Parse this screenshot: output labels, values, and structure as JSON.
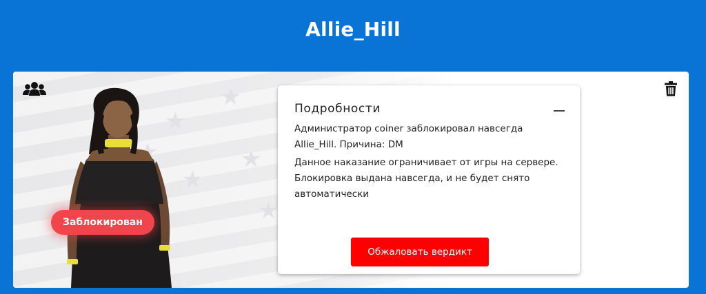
{
  "header": {
    "title": "Allie_Hill"
  },
  "card": {
    "status_badge": "Заблокирован",
    "details": {
      "title": "Подробности",
      "line1": "Администратор coiner заблокировал навсегда Allie_Hill. Причина: DM",
      "line2": "Данное наказание ограничивает от игры на сервере. Блокировка выдана навсегда, и не будет снято автоматически",
      "appeal_button": "Обжаловать вердикт"
    }
  },
  "icons": {
    "group": "users-icon",
    "trash": "trash-icon",
    "collapse": "minus-icon"
  },
  "colors": {
    "background": "#0a73d6",
    "badge": "#f0454b",
    "button": "#ff0000"
  }
}
